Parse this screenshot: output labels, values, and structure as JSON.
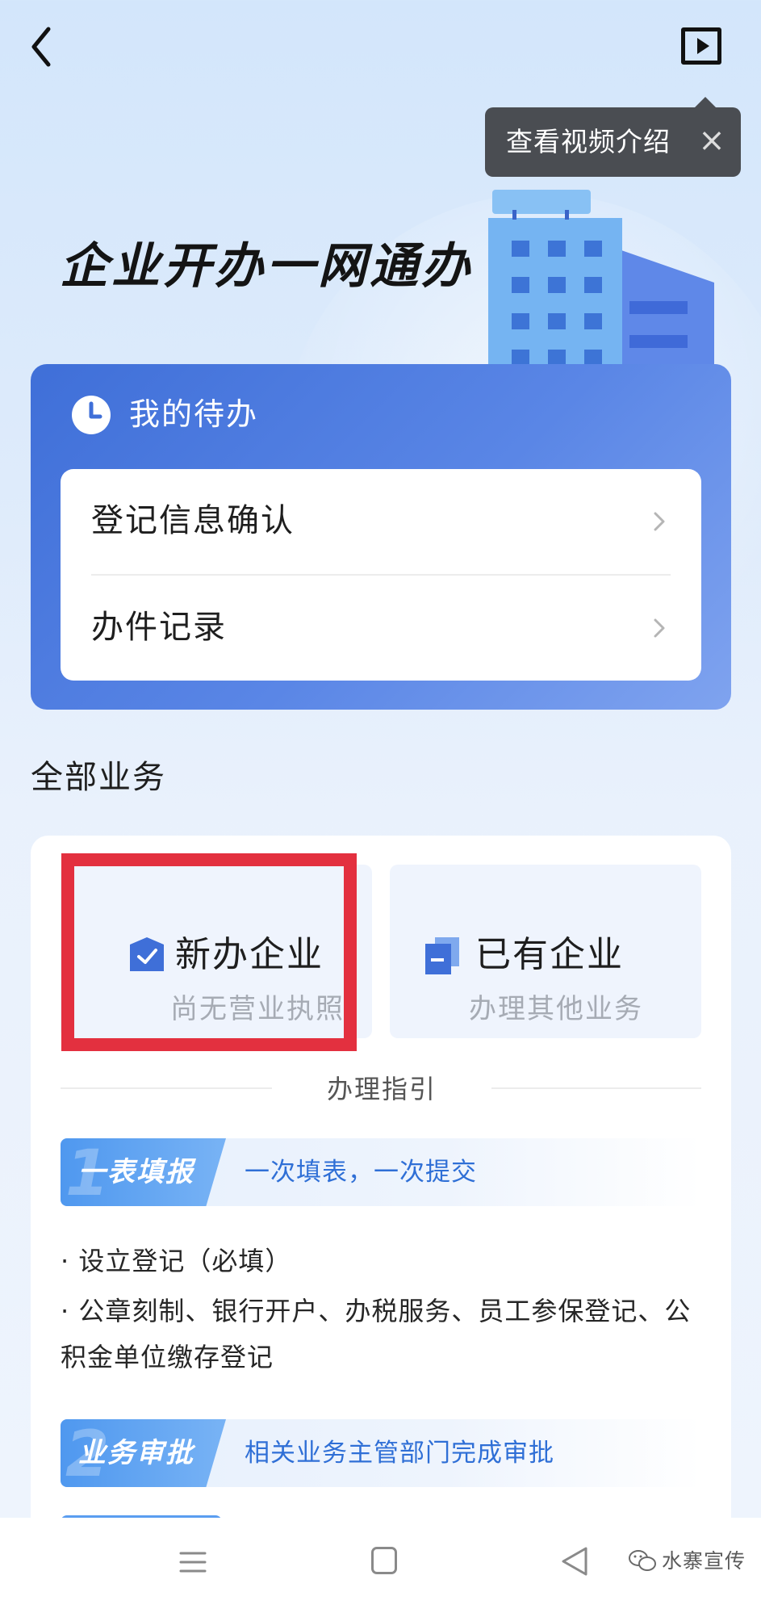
{
  "tooltip": {
    "text": "查看视频介绍",
    "close": "×"
  },
  "hero": {
    "title": "企业开办一网通办"
  },
  "todo": {
    "title": "我的待办",
    "items": [
      {
        "label": "登记信息确认"
      },
      {
        "label": "办件记录"
      }
    ]
  },
  "services": {
    "title": "全部业务",
    "tiles": [
      {
        "title": "新办企业",
        "subtitle": "尚无营业执照"
      },
      {
        "title": "已有企业",
        "subtitle": "办理其他业务"
      }
    ],
    "guide_label": "办理指引",
    "steps": [
      {
        "num": "1",
        "name": "一表填报",
        "desc": "一次填表，一次提交"
      },
      {
        "num": "2",
        "name": "业务审批",
        "desc": "相关业务主管部门完成审批"
      }
    ],
    "bullets": [
      "· 设立登记（必填）",
      "· 公章刻制、银行开户、办税服务、员工参保登记、公",
      "积金单位缴存登记"
    ]
  },
  "watermark": {
    "text": "水寨宣传"
  },
  "colors": {
    "accent_blue": "#3f6fd8",
    "highlight_red": "#e3303f",
    "step_text_blue": "#2f6fd6",
    "tooltip_bg": "#4a4d52"
  },
  "icons": [
    "back-arrow-icon",
    "play-icon",
    "close-icon",
    "building-illustration",
    "clock-icon",
    "chevron-right-icon",
    "shield-check-icon",
    "document-icon",
    "menu-icon",
    "home-icon",
    "back-triangle-icon",
    "wechat-icon"
  ]
}
